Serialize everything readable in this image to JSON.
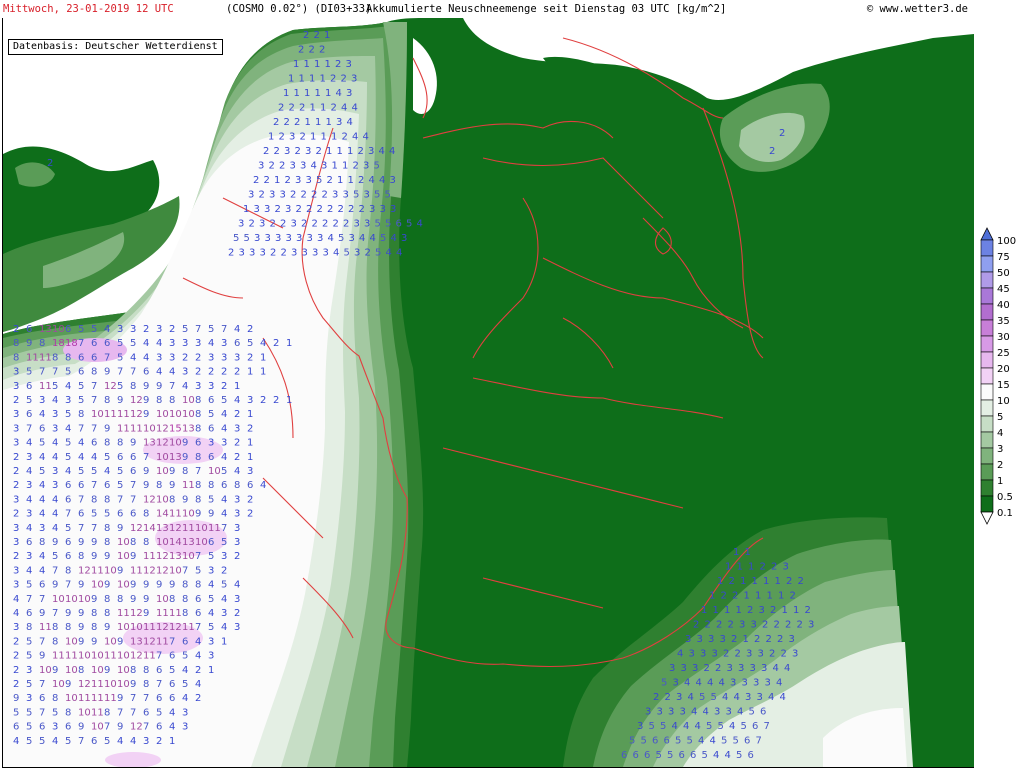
{
  "header": {
    "date": "Mittwoch, 23-01-2019  12 UTC",
    "model": "(COSMO 0.02°) (DI03+33)",
    "title": "Akkumulierte Neuschneemenge seit Dienstag 03 UTC [kg/m^2]",
    "copyright": "© www.wetter3.de"
  },
  "basis_label": "Datenbasis: Deutscher Wetterdienst",
  "legend": {
    "levels": [
      "100",
      "75",
      "50",
      "45",
      "40",
      "35",
      "30",
      "25",
      "20",
      "15",
      "10",
      "5",
      "4",
      "3",
      "2",
      "1",
      "0.5",
      "0.1"
    ],
    "colors": [
      "#4f6fd8",
      "#6c82e3",
      "#8f9ff0",
      "#b09be8",
      "#a978d8",
      "#b26ecf",
      "#c77fd8",
      "#d79ae6",
      "#e7b8ef",
      "#f2d2f5",
      "#fbfbfb",
      "#e4efe4",
      "#c7dec6",
      "#a4c9a2",
      "#80b37d",
      "#5a9c57",
      "#2f8030",
      "#0e6e1a"
    ],
    "arrow_icon": "triangle"
  },
  "snow_values": {
    "west_block": [
      "2 6 13 10 6 5 5 4 3 3 2 3 2 5 7 5 7 4 2",
      "8 9 8 18 18 7 6 6 5 5 4 4 3 3 3 4 3 6 5 4 2 1",
      "8 11 11 8 8 6 6 7 5 4 4 3 3 2 2 3 3 3 2 1",
      "3 5 7 7 5 6 8 9 7 7 6 4 4 3 2 2 2 2 1 1",
      "3 6 11 5 4 5 7 12 5 8 9 9 7 4 3 3 2 1",
      "2 5 3 4 3 5 7 8 9 12 9 8 8 10 8 6 5 4 3 2 2 1",
      "3 6 4 3 5 8 10 11 11 12 9 10 10 10 8 5 4 2 1",
      "3 7 6 3 4 7 7 9 11 11 10 12 15 13 8 6 4 3 2",
      "3 4 5 4 5 4 6 8 8 9 13 12 10 9 6 3 3 2 1",
      "2 3 4 4 5 4 4 5 6 6 7 10 13 9 8 6 4 2 1",
      "2 4 5 3 4 5 5 4 5 6 9 10 9 8 7 10 5 4 3",
      "2 3 4 3 6 6 7 6 5 7 9 8 9 11 8 8 6 8 6 4",
      "3 4 4 4 6 7 8 8 7 7 12 10 8 9 8 5 4 3 2",
      "2 3 4 4 7 6 5 5 6 6 8 14 11 10 9 9 4 3 2",
      "3 4 3 4 5 7 7 8 9 12 14 13 12 11 10 11 7 3",
      "3 6 8 9 6 9 9 8 10 8 8 10 14 13 10 6 5 3",
      "2 3 4 5 6 8 9 9 10 9 11 12 13 10 7 5 3 2",
      "3 4 4 7 8 12 11 10 9 11 12 12 10 7 5 3 2",
      "3 5 6 9 7 9 10 9 10 9 9 9 9 8 8 4 5 4",
      "4 7 7 10 10 10 9 8 8 9 9 10 8 8 6 5 4 3",
      "4 6 9 7 9 9 8 8 11 12 9 11 11 8 6 4 3 2",
      "3 8 11 8 8 9 8 9 10 10 11 12 12 11 7 5 4 3",
      "2 5 7 8 10 9 9 10 9 13 12 11 7 6 4 3 1",
      "2 5 9 11 11 10 10 11 10 12 11 7 6 5 4 3",
      "2 3 10 9 10 8 10 9 10 8 8 6 5 4 2 1",
      "2 5 7 10 9 12 11 10 10 9 8 7 6 5 4",
      "9 3 6 8 10 11 11 11 9 7 7 6 6 4 2",
      "5 5 7 5 8 10 11 8 7 7 6 5 4 3",
      "6 5 6 3 6 9 10 7 9 12 7 6 4 3",
      "4 5 5 4 5 7 6 5 4 4 3 2 1"
    ],
    "sea_block": [
      "2 2 1",
      "2 2 2",
      "1 1 1 1 2 3",
      "1 1 1 1 2 2 3",
      "1 1 1 1 1 4 3",
      "2 2 2 1 1 2 4 4",
      "2 2 2 1 1 1 3 4",
      "1 2 3 2 1 1 1 2 4 4",
      "2 2 3 2 3 2 1 1 1 2 3 4 4",
      "3 2 2 3 3 4 3 1 1 2 3 5",
      "2 2 1 2 3 3 5 2 1 1 2 4 4 3",
      "3 2 3 3 2 2 2 2 3 3 5 3 5 5",
      "1 3 3 2 3 2 2 2 2 2 2 2 3 3 3",
      "3 2 3 2 2 3 2 2 2 2 2 3 3 5 5 6 5 4",
      "5 5 3 3 3 3 3 3 3 4 5 3 4 4 5 4 3",
      "2 3 3 3 2 2 3 3 3 3 4 5 3 2 5 4 4"
    ],
    "alps_block": [
      "1 1",
      "1 1 1 2 2 3",
      "1 2 1 1 1 1 2 2",
      "1 2 2 1 1 1 1 2",
      "1 1 1 1 2 3 2 1 1 2",
      "2 2 2 2 3 3 2 2 2 2 3",
      "3 3 3 3 2 1 2 2 2 3",
      "4 3 3 3 2 2 3 3 2 2 3",
      "3 3 3 2 2 3 3 3 3 4 4",
      "5 3 4 4 4 4 3 3 3 3 4",
      "2 2 3 4 5 5 4 4 3 3 4 4",
      "3 3 3 3 4 4 3 3 4 5 6",
      "3 5 5 4 4 4 5 5 4 5 6 7",
      "5 5 6 6 5 5 4 4 5 5 6 7",
      "6 6 6 5 5 6 6 5 4 4 5 6"
    ],
    "poland_block": [
      "2",
      "2"
    ],
    "uk_block": [
      "2"
    ]
  }
}
